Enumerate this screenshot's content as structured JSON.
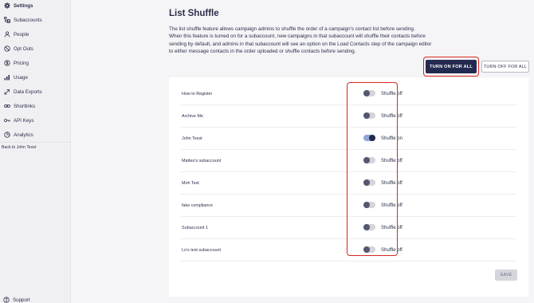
{
  "sidebar": {
    "items": [
      {
        "label": "Settings",
        "icon": "gear-icon",
        "active": true
      },
      {
        "label": "Subaccounts",
        "icon": "subaccounts-icon"
      },
      {
        "label": "People",
        "icon": "person-icon"
      },
      {
        "label": "Opt Outs",
        "icon": "block-icon"
      },
      {
        "label": "Pricing",
        "icon": "dollar-icon"
      },
      {
        "label": "Usage",
        "icon": "bar-chart-icon"
      },
      {
        "label": "Data Exports",
        "icon": "export-icon"
      },
      {
        "label": "Shortlinks",
        "icon": "link-icon"
      },
      {
        "label": "API Keys",
        "icon": "key-icon"
      },
      {
        "label": "Analytics",
        "icon": "pie-chart-icon"
      }
    ],
    "back_link": "Back to John Tesst",
    "support_label": "Support"
  },
  "main": {
    "title": "List Shuffle",
    "description": [
      "The list shuffle feature allows campaign admins to shuffle the order of a campaign's contact list before sending.",
      "When this feature is turned on for a subaccount, new campaigns in that subaccount will shuffle their contacts before",
      "sending by default, and admins in that subaccount will see an option on the Load Contacts step of the campaign editor",
      "to either message contacts in the order uploaded or shuffle contacts before sending."
    ],
    "turn_on_all_label": "TURN ON FOR ALL",
    "turn_off_all_label": "TURN OFF FOR ALL",
    "save_label": "SAVE",
    "subaccounts": [
      {
        "name": "How to Register",
        "status": "Shuffle off",
        "on": false
      },
      {
        "name": "Archive Me",
        "status": "Shuffle off",
        "on": false
      },
      {
        "name": "John Tesst",
        "status": "Shuffle on",
        "on": true
      },
      {
        "name": "Matteo's subaccount",
        "status": "Shuffle off",
        "on": false
      },
      {
        "name": "Moh Test",
        "status": "Shuffle off",
        "on": false
      },
      {
        "name": "fake compliance",
        "status": "Shuffle off",
        "on": false
      },
      {
        "name": "Subaccount 1",
        "status": "Shuffle off",
        "on": false
      },
      {
        "name": "Lo's test subaccount",
        "status": "Shuffle off",
        "on": false
      }
    ]
  },
  "colors": {
    "primary": "#23294f",
    "highlight": "#d7281e",
    "toggle_on_track": "#8da6d6"
  }
}
